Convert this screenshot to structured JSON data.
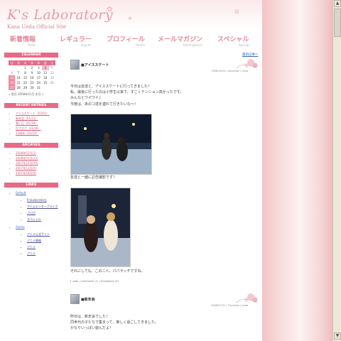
{
  "site": {
    "title": "K's Laboratory",
    "subtitle": "Kana Ueda Official Site"
  },
  "nav": [
    {
      "jp": "新着情報",
      "en": "News"
    },
    {
      "jp": "レギュラー",
      "en": "Regular"
    },
    {
      "jp": "プロフィール",
      "en": "Profile"
    },
    {
      "jp": "メールマガジン",
      "en": "Mailmagazine"
    },
    {
      "jp": "スペシャル",
      "en": "Special"
    }
  ],
  "sidebar": {
    "calendar_title": "CALENDAR",
    "calendar_days": [
      "日",
      "月",
      "火",
      "水",
      "木",
      "金",
      "土"
    ],
    "calendar_rows": [
      [
        "",
        "",
        "1",
        "2",
        "3",
        "4",
        "5"
      ],
      [
        "6",
        "7",
        "8",
        "9",
        "10",
        "11",
        "12"
      ],
      [
        "13",
        "14",
        "15",
        "16",
        "17",
        "18",
        "19"
      ],
      [
        "20",
        "21",
        "22",
        "23",
        "24",
        "25",
        "26"
      ],
      [
        "27",
        "28",
        "29",
        "30",
        "31",
        "",
        ""
      ]
    ],
    "calendar_nav": "« 前月 2008年01月 次月 »",
    "recent_title": "RECENT ENTRIES",
    "recent": [
      "アイススケート（02/02）",
      "新年会（01/31）",
      "寒い日（01/28）",
      "ひさびさ（01/26）",
      "12周年（01/24）"
    ],
    "archives_title": "ARCHIVES",
    "archives": [
      "2008年02月(1)",
      "2008年01月(13)",
      "2007年12月(10)",
      "2007年11月(9)",
      "2007年10月(8)"
    ],
    "links_title": "LINKS",
    "links_group1": "Default",
    "links_group1_items": [
      "K'sLaboratory",
      "アイムエンタープライズ",
      "ブログ",
      "スペシャル"
    ],
    "links_group2": "Anime",
    "links_group2_items": [
      "アニメ公式サイト",
      "アニメ情報",
      "アニメ",
      "アニメ"
    ]
  },
  "main": {
    "top_link": "最新記事へ",
    "entry1": {
      "title": "■アイススケート",
      "meta": "2008/02/02 | Saturday | ueda",
      "body": [
        "今日は友達と、アイススケートに行ってきました！",
        "私、最後に行ったのは小学生以来で、すごくテンション高かったです。",
        "みんなとワイワイ♪",
        "今度は、あのコ達を連れて行きたいな〜！"
      ],
      "caption1": "友達と一緒に記念撮影です！",
      "caption2": "それにしても、この二人、パパラッチですね。",
      "footer": "[ ueda ] comments (1) | trackbacks (0)"
    },
    "entry2": {
      "title": "■新年会",
      "meta": "2008/01/31 | Thursday | ueda",
      "body": [
        "昨日は、新年会でした！",
        "同世代の子たちで集まって、楽しく過ごしてきました。",
        "かなりいっぱい遊んだよ！"
      ]
    }
  }
}
